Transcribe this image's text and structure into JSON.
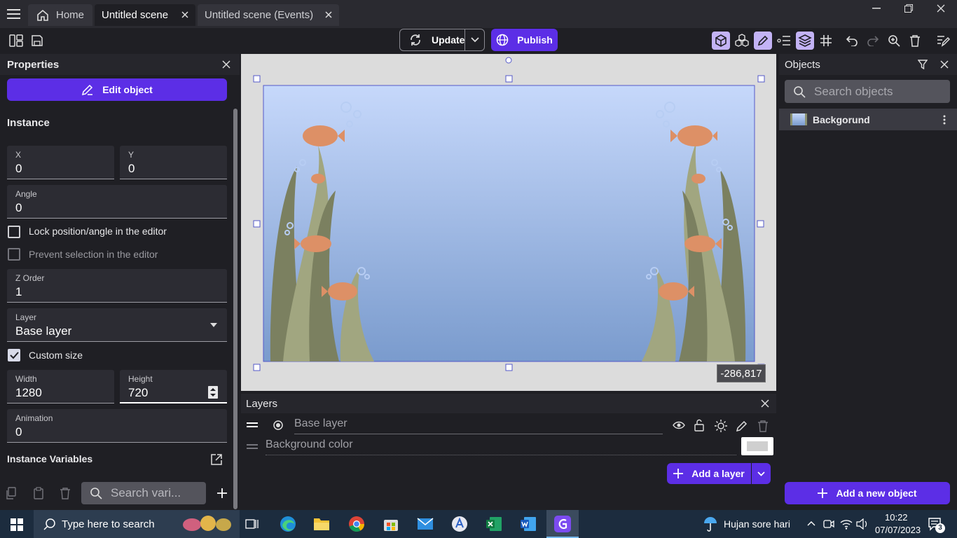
{
  "titlebar": {
    "tabs": [
      {
        "label": "Home"
      },
      {
        "label": "Untitled scene"
      },
      {
        "label": "Untitled scene (Events)"
      }
    ]
  },
  "toolbar": {
    "update_label": "Update",
    "publish_label": "Publish"
  },
  "properties": {
    "title": "Properties",
    "edit_object_label": "Edit object",
    "instance_heading": "Instance",
    "x": {
      "label": "X",
      "value": "0"
    },
    "y": {
      "label": "Y",
      "value": "0"
    },
    "angle": {
      "label": "Angle",
      "value": "0"
    },
    "lock_label": "Lock position/angle in the editor",
    "prevent_label": "Prevent selection in the editor",
    "zorder": {
      "label": "Z Order",
      "value": "1"
    },
    "layer": {
      "label": "Layer",
      "value": "Base layer"
    },
    "custom_size_label": "Custom size",
    "width": {
      "label": "Width",
      "value": "1280"
    },
    "height": {
      "label": "Height",
      "value": "720"
    },
    "animation": {
      "label": "Animation",
      "value": "0"
    },
    "instance_variables_label": "Instance Variables",
    "search_variables_placeholder": "Search vari..."
  },
  "canvas": {
    "cursor_coords": "-286,817"
  },
  "layers": {
    "title": "Layers",
    "base_layer": "Base layer",
    "background_color": "Background color",
    "add_layer_label": "Add a layer"
  },
  "objects": {
    "title": "Objects",
    "search_placeholder": "Search objects",
    "items": [
      {
        "name": "Backgorund"
      }
    ],
    "add_new_label": "Add a new object"
  },
  "taskbar": {
    "search_placeholder": "Type here to search",
    "weather": "Hujan sore hari",
    "time": "10:22",
    "date": "07/07/2023",
    "notifications": "3"
  }
}
